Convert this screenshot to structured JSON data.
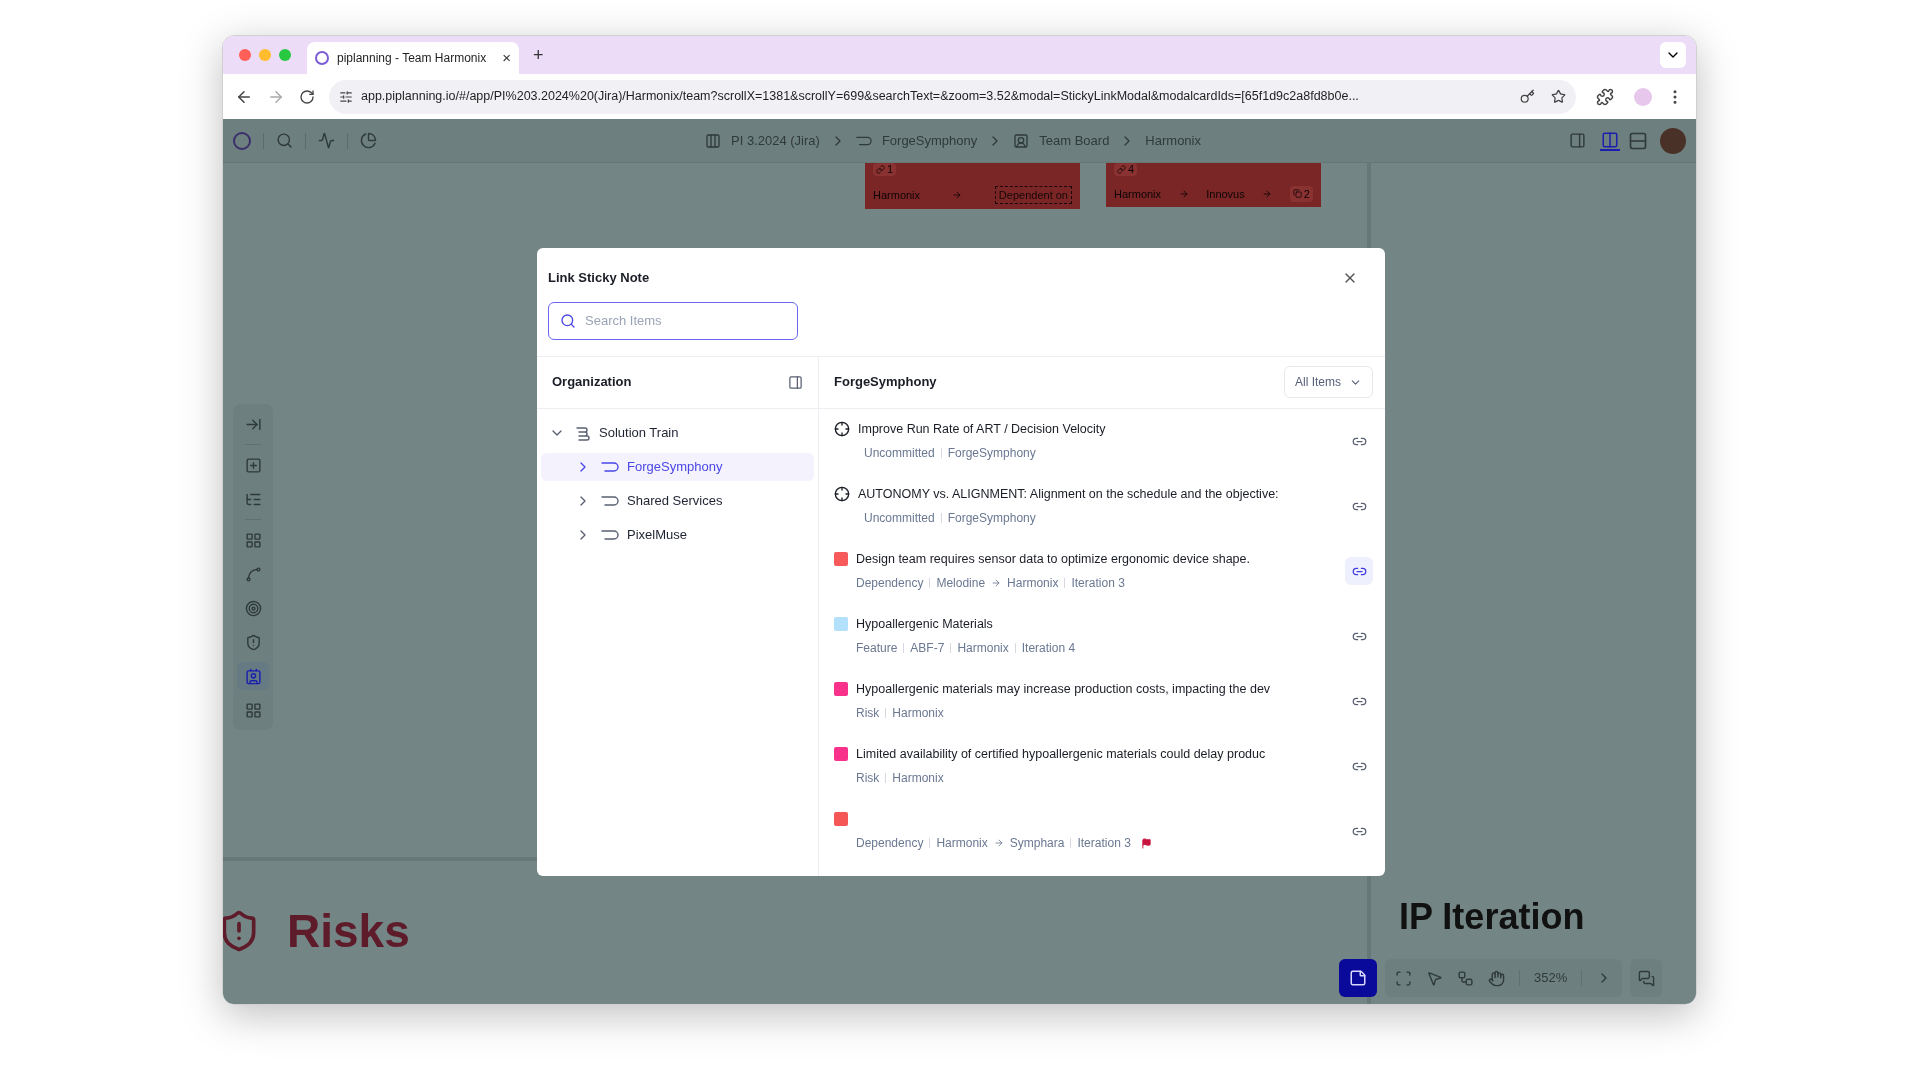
{
  "browser": {
    "tab": {
      "title": "piplanning - Team Harmonix",
      "close": "×"
    },
    "new_tab": "+",
    "url": "app.piplanning.io/#/app/PI%203.2024%20(Jira)/Harmonix/team?scrollX=1381&scrollY=699&searchText=&zoom=3.52&modal=StickyLinkModal&modalcardIds=[65f1d9c2a8fd8b0e..."
  },
  "app_bar": {
    "breadcrumbs": [
      {
        "label": "PI 3.2024 (Jira)",
        "kind": "board"
      },
      {
        "label": "ForgeSymphony",
        "kind": "art"
      },
      {
        "label": "Team Board",
        "kind": "team"
      },
      {
        "label": "Harmonix",
        "kind": "plain"
      }
    ],
    "views": [
      {
        "kind": "board",
        "selected": true
      },
      {
        "kind": "list",
        "selected": false
      }
    ]
  },
  "left_tools": [
    {
      "kind": "collapse",
      "selected": false
    },
    {
      "kind": "add-group",
      "selected": false
    },
    {
      "kind": "tree",
      "selected": false
    },
    {
      "kind": "add-items",
      "selected": false
    },
    {
      "kind": "path",
      "selected": false
    },
    {
      "kind": "target",
      "selected": false
    },
    {
      "kind": "shield",
      "selected": false
    },
    {
      "kind": "team",
      "selected": true
    },
    {
      "kind": "grid",
      "selected": false
    }
  ],
  "canvas": {
    "cards": [
      {
        "link_count": "1",
        "from": "Harmonix",
        "to": "Dependent on",
        "kind": "placeholder"
      },
      {
        "link_count": "4",
        "from": "Harmonix",
        "to": "Innovus",
        "extra": "2",
        "kind": "linked"
      }
    ],
    "sections": [
      {
        "title": "Risks",
        "kind": "risks"
      },
      {
        "title": "IP Iteration",
        "kind": "plain"
      }
    ],
    "zoom": "352%"
  },
  "modal": {
    "title": "Link Sticky Note",
    "search": {
      "placeholder": "Search Items"
    },
    "tree": {
      "title": "Organization",
      "items": [
        {
          "label": "Solution Train",
          "kind": "train",
          "expanded": true,
          "selected": false,
          "children": [
            {
              "label": "ForgeSymphony",
              "kind": "art",
              "expanded": false,
              "selected": true
            },
            {
              "label": "Shared Services",
              "kind": "art",
              "expanded": false,
              "selected": false
            },
            {
              "label": "PixelMuse",
              "kind": "art",
              "expanded": false,
              "selected": false
            }
          ]
        }
      ]
    },
    "list": {
      "title": "ForgeSymphony",
      "filter": "All Items",
      "items": [
        {
          "kind": "objective",
          "title": "Improve Run Rate of ART / Decision Velocity",
          "meta": [
            {
              "text": "Uncommitted"
            },
            {
              "text": "ForgeSymphony"
            }
          ],
          "linked": false
        },
        {
          "kind": "objective",
          "title": "AUTONOMY vs. ALIGNMENT: Alignment on the schedule and the objective:",
          "meta": [
            {
              "text": "Uncommitted"
            },
            {
              "text": "ForgeSymphony"
            }
          ],
          "linked": false
        },
        {
          "kind": "sticky",
          "color": "#f65a5a",
          "title": "Design team requires sensor data to optimize ergonomic device shape.",
          "meta": [
            {
              "text": "Dependency"
            },
            {
              "text": "Melodine"
            },
            {
              "text": "Harmonix",
              "arrow": true
            },
            {
              "text": "Iteration 3"
            }
          ],
          "linked": true
        },
        {
          "kind": "sticky",
          "color": "#b3e0fa",
          "title": "Hypoallergenic Materials",
          "meta": [
            {
              "text": "Feature"
            },
            {
              "text": "ABF-7"
            },
            {
              "text": "Harmonix"
            },
            {
              "text": "Iteration 4"
            }
          ],
          "linked": false
        },
        {
          "kind": "sticky",
          "color": "#f8318b",
          "title": "Hypoallergenic materials may increase production costs, impacting the dev",
          "meta": [
            {
              "text": "Risk"
            },
            {
              "text": "Harmonix"
            }
          ],
          "linked": false
        },
        {
          "kind": "sticky",
          "color": "#f8318b",
          "title": "Limited availability of certified hypoallergenic materials could delay produc",
          "meta": [
            {
              "text": "Risk"
            },
            {
              "text": "Harmonix"
            }
          ],
          "linked": false
        },
        {
          "kind": "sticky",
          "color": "#f55656",
          "meta": [
            {
              "text": "Dependency"
            },
            {
              "text": "Harmonix"
            },
            {
              "text": "Symphara",
              "arrow": true
            },
            {
              "text": "Iteration 3"
            }
          ],
          "flagged": true,
          "linked": false
        }
      ]
    }
  }
}
